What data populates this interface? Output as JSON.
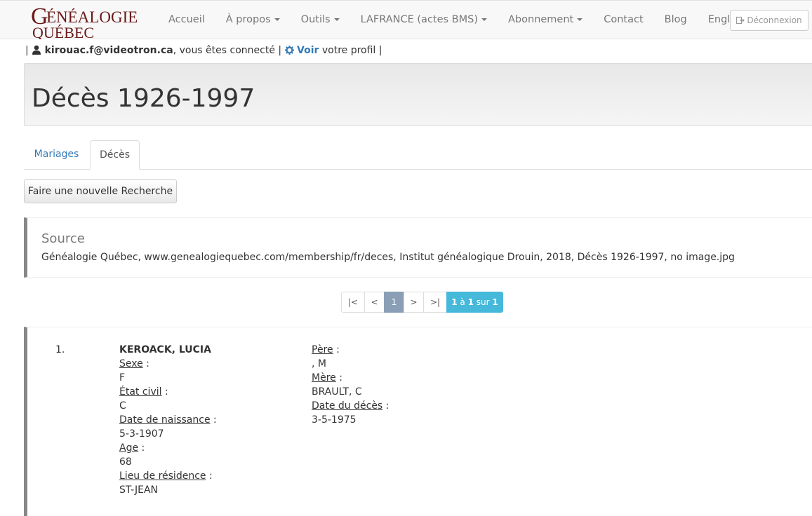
{
  "brand": {
    "line1": "GÉNÉALOGIE",
    "line2": "QUÉBEC",
    "color": "#6b1a1a"
  },
  "nav": {
    "items": [
      {
        "label": "Accueil",
        "dropdown": false
      },
      {
        "label": "À propos",
        "dropdown": true
      },
      {
        "label": "Outils",
        "dropdown": true
      },
      {
        "label": "LAFRANCE (actes BMS)",
        "dropdown": true
      },
      {
        "label": "Abonnement",
        "dropdown": true
      },
      {
        "label": "Contact",
        "dropdown": false
      },
      {
        "label": "Blog",
        "dropdown": false
      },
      {
        "label": "English",
        "dropdown": false
      }
    ],
    "logout_label": "Déconnexion"
  },
  "userbar": {
    "sep_left": "|",
    "email": "kirouac.f@videotron.ca",
    "connected_text": ", vous êtes connecté |",
    "voir_label": "Voir",
    "profile_text": "votre profil |"
  },
  "page": {
    "title": "Décès 1926-1997"
  },
  "tabs": [
    {
      "label": "Mariages",
      "active": false
    },
    {
      "label": "Décès",
      "active": true
    }
  ],
  "search_button_label": "Faire une nouvelle Recherche",
  "source": {
    "title": "Source",
    "text": "Généalogie Québec, www.genealogiequebec.com/membership/fr/deces, Institut généalogique Drouin, 2018, Décès 1926-1997, no image.jpg"
  },
  "pagination": {
    "first": "|<",
    "prev": "<",
    "current": "1",
    "next": ">",
    "last": ">|",
    "info_from": "1",
    "info_to_word": "à",
    "info_to": "1",
    "info_of_word": "sur",
    "info_total": "1"
  },
  "record": {
    "number": "1.",
    "name": "KEROACK, LUCIA",
    "sexe_label": "Sexe",
    "sexe": "F",
    "etat_label": "État civil",
    "etat": "C",
    "naissance_label": "Date de naissance",
    "naissance": "5-3-1907",
    "age_label": "Age",
    "age": "68",
    "residence_label": "Lieu de résidence",
    "residence": "ST-JEAN",
    "pere_label": "Père",
    "pere": ", M",
    "mere_label": "Mère",
    "mere": "BRAULT, C",
    "deces_label": "Date du décès",
    "deces": "3-5-1975"
  },
  "colors": {
    "link": "#337ab7",
    "accent_info": "#46b8da",
    "current_page": "#8a9fb5"
  }
}
